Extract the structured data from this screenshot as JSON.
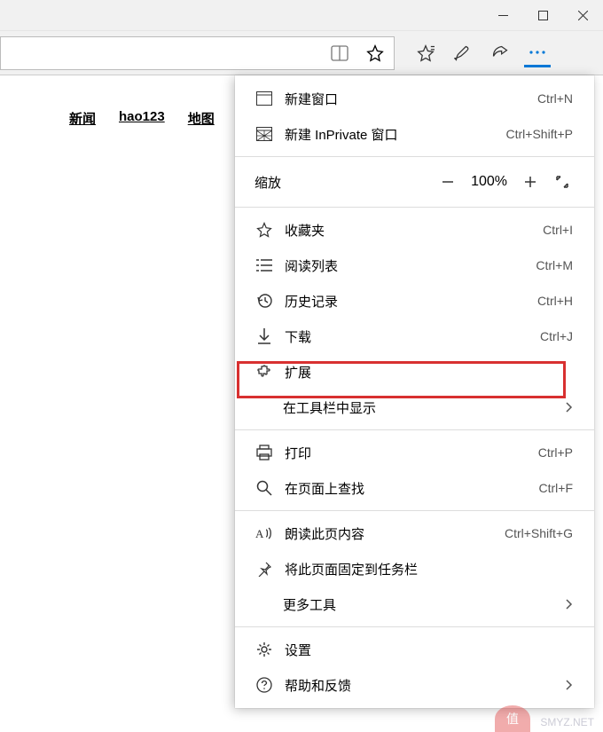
{
  "window": {
    "minimize": "─",
    "maximize": "☐",
    "close": "✕"
  },
  "page": {
    "links": [
      "新闻",
      "hao123",
      "地图"
    ]
  },
  "zoom": {
    "label": "缩放",
    "value": "100%"
  },
  "menu": {
    "new_window": {
      "label": "新建窗口",
      "shortcut": "Ctrl+N"
    },
    "new_inprivate": {
      "label": "新建 InPrivate 窗口",
      "shortcut": "Ctrl+Shift+P"
    },
    "favorites": {
      "label": "收藏夹",
      "shortcut": "Ctrl+I"
    },
    "reading_list": {
      "label": "阅读列表",
      "shortcut": "Ctrl+M"
    },
    "history": {
      "label": "历史记录",
      "shortcut": "Ctrl+H"
    },
    "downloads": {
      "label": "下载",
      "shortcut": "Ctrl+J"
    },
    "extensions": {
      "label": "扩展"
    },
    "show_in_toolbar": {
      "label": "在工具栏中显示"
    },
    "print": {
      "label": "打印",
      "shortcut": "Ctrl+P"
    },
    "find": {
      "label": "在页面上查找",
      "shortcut": "Ctrl+F"
    },
    "read_aloud": {
      "label": "朗读此页内容",
      "shortcut": "Ctrl+Shift+G"
    },
    "pin_taskbar": {
      "label": "将此页面固定到任务栏"
    },
    "more_tools": {
      "label": "更多工具"
    },
    "settings": {
      "label": "设置"
    },
    "help": {
      "label": "帮助和反馈"
    }
  },
  "watermark": "SMYZ.NET",
  "wm_badge": "值"
}
